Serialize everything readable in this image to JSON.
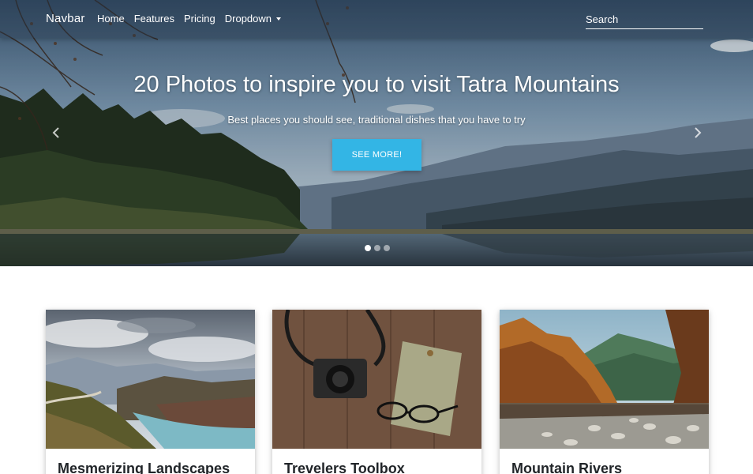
{
  "navbar": {
    "brand": "Navbar",
    "links": [
      "Home",
      "Features",
      "Pricing",
      "Dropdown"
    ],
    "search_placeholder": "Search"
  },
  "hero": {
    "title": "20 Photos to inspire you to visit Tatra Mountains",
    "subtitle": "Best places you should see, traditional dishes that you have to try",
    "button_label": "SEE MORE!",
    "slide_count": 3,
    "active_slide": 1
  },
  "cards": [
    {
      "title": "Mesmerizing Landscapes"
    },
    {
      "title": "Trevelers Toolbox"
    },
    {
      "title": "Mountain Rivers"
    }
  ],
  "colors": {
    "accent": "#33b5e5",
    "navbar_bg": "#263446",
    "text": "#212529"
  },
  "icons": [
    "chevron-left-icon",
    "chevron-right-icon",
    "caret-down-icon"
  ]
}
